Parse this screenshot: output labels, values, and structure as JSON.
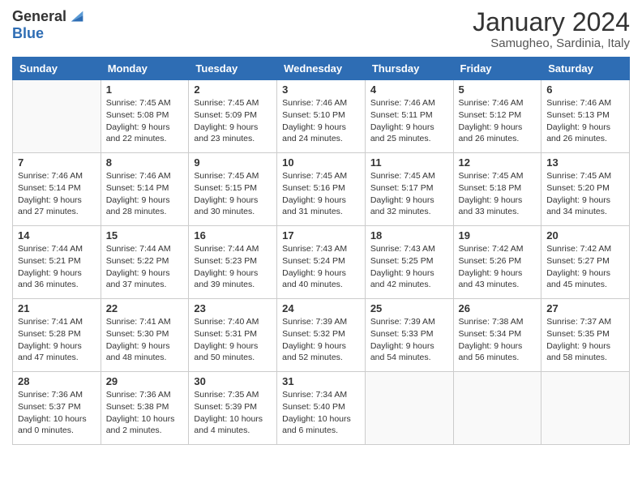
{
  "logo": {
    "text_general": "General",
    "text_blue": "Blue"
  },
  "header": {
    "month_title": "January 2024",
    "location": "Samugheo, Sardinia, Italy"
  },
  "weekdays": [
    "Sunday",
    "Monday",
    "Tuesday",
    "Wednesday",
    "Thursday",
    "Friday",
    "Saturday"
  ],
  "weeks": [
    [
      {
        "day": "",
        "sunrise": "",
        "sunset": "",
        "daylight": ""
      },
      {
        "day": "1",
        "sunrise": "Sunrise: 7:45 AM",
        "sunset": "Sunset: 5:08 PM",
        "daylight": "Daylight: 9 hours and 22 minutes."
      },
      {
        "day": "2",
        "sunrise": "Sunrise: 7:45 AM",
        "sunset": "Sunset: 5:09 PM",
        "daylight": "Daylight: 9 hours and 23 minutes."
      },
      {
        "day": "3",
        "sunrise": "Sunrise: 7:46 AM",
        "sunset": "Sunset: 5:10 PM",
        "daylight": "Daylight: 9 hours and 24 minutes."
      },
      {
        "day": "4",
        "sunrise": "Sunrise: 7:46 AM",
        "sunset": "Sunset: 5:11 PM",
        "daylight": "Daylight: 9 hours and 25 minutes."
      },
      {
        "day": "5",
        "sunrise": "Sunrise: 7:46 AM",
        "sunset": "Sunset: 5:12 PM",
        "daylight": "Daylight: 9 hours and 26 minutes."
      },
      {
        "day": "6",
        "sunrise": "Sunrise: 7:46 AM",
        "sunset": "Sunset: 5:13 PM",
        "daylight": "Daylight: 9 hours and 26 minutes."
      }
    ],
    [
      {
        "day": "7",
        "sunrise": "Sunrise: 7:46 AM",
        "sunset": "Sunset: 5:14 PM",
        "daylight": "Daylight: 9 hours and 27 minutes."
      },
      {
        "day": "8",
        "sunrise": "Sunrise: 7:46 AM",
        "sunset": "Sunset: 5:14 PM",
        "daylight": "Daylight: 9 hours and 28 minutes."
      },
      {
        "day": "9",
        "sunrise": "Sunrise: 7:45 AM",
        "sunset": "Sunset: 5:15 PM",
        "daylight": "Daylight: 9 hours and 30 minutes."
      },
      {
        "day": "10",
        "sunrise": "Sunrise: 7:45 AM",
        "sunset": "Sunset: 5:16 PM",
        "daylight": "Daylight: 9 hours and 31 minutes."
      },
      {
        "day": "11",
        "sunrise": "Sunrise: 7:45 AM",
        "sunset": "Sunset: 5:17 PM",
        "daylight": "Daylight: 9 hours and 32 minutes."
      },
      {
        "day": "12",
        "sunrise": "Sunrise: 7:45 AM",
        "sunset": "Sunset: 5:18 PM",
        "daylight": "Daylight: 9 hours and 33 minutes."
      },
      {
        "day": "13",
        "sunrise": "Sunrise: 7:45 AM",
        "sunset": "Sunset: 5:20 PM",
        "daylight": "Daylight: 9 hours and 34 minutes."
      }
    ],
    [
      {
        "day": "14",
        "sunrise": "Sunrise: 7:44 AM",
        "sunset": "Sunset: 5:21 PM",
        "daylight": "Daylight: 9 hours and 36 minutes."
      },
      {
        "day": "15",
        "sunrise": "Sunrise: 7:44 AM",
        "sunset": "Sunset: 5:22 PM",
        "daylight": "Daylight: 9 hours and 37 minutes."
      },
      {
        "day": "16",
        "sunrise": "Sunrise: 7:44 AM",
        "sunset": "Sunset: 5:23 PM",
        "daylight": "Daylight: 9 hours and 39 minutes."
      },
      {
        "day": "17",
        "sunrise": "Sunrise: 7:43 AM",
        "sunset": "Sunset: 5:24 PM",
        "daylight": "Daylight: 9 hours and 40 minutes."
      },
      {
        "day": "18",
        "sunrise": "Sunrise: 7:43 AM",
        "sunset": "Sunset: 5:25 PM",
        "daylight": "Daylight: 9 hours and 42 minutes."
      },
      {
        "day": "19",
        "sunrise": "Sunrise: 7:42 AM",
        "sunset": "Sunset: 5:26 PM",
        "daylight": "Daylight: 9 hours and 43 minutes."
      },
      {
        "day": "20",
        "sunrise": "Sunrise: 7:42 AM",
        "sunset": "Sunset: 5:27 PM",
        "daylight": "Daylight: 9 hours and 45 minutes."
      }
    ],
    [
      {
        "day": "21",
        "sunrise": "Sunrise: 7:41 AM",
        "sunset": "Sunset: 5:28 PM",
        "daylight": "Daylight: 9 hours and 47 minutes."
      },
      {
        "day": "22",
        "sunrise": "Sunrise: 7:41 AM",
        "sunset": "Sunset: 5:30 PM",
        "daylight": "Daylight: 9 hours and 48 minutes."
      },
      {
        "day": "23",
        "sunrise": "Sunrise: 7:40 AM",
        "sunset": "Sunset: 5:31 PM",
        "daylight": "Daylight: 9 hours and 50 minutes."
      },
      {
        "day": "24",
        "sunrise": "Sunrise: 7:39 AM",
        "sunset": "Sunset: 5:32 PM",
        "daylight": "Daylight: 9 hours and 52 minutes."
      },
      {
        "day": "25",
        "sunrise": "Sunrise: 7:39 AM",
        "sunset": "Sunset: 5:33 PM",
        "daylight": "Daylight: 9 hours and 54 minutes."
      },
      {
        "day": "26",
        "sunrise": "Sunrise: 7:38 AM",
        "sunset": "Sunset: 5:34 PM",
        "daylight": "Daylight: 9 hours and 56 minutes."
      },
      {
        "day": "27",
        "sunrise": "Sunrise: 7:37 AM",
        "sunset": "Sunset: 5:35 PM",
        "daylight": "Daylight: 9 hours and 58 minutes."
      }
    ],
    [
      {
        "day": "28",
        "sunrise": "Sunrise: 7:36 AM",
        "sunset": "Sunset: 5:37 PM",
        "daylight": "Daylight: 10 hours and 0 minutes."
      },
      {
        "day": "29",
        "sunrise": "Sunrise: 7:36 AM",
        "sunset": "Sunset: 5:38 PM",
        "daylight": "Daylight: 10 hours and 2 minutes."
      },
      {
        "day": "30",
        "sunrise": "Sunrise: 7:35 AM",
        "sunset": "Sunset: 5:39 PM",
        "daylight": "Daylight: 10 hours and 4 minutes."
      },
      {
        "day": "31",
        "sunrise": "Sunrise: 7:34 AM",
        "sunset": "Sunset: 5:40 PM",
        "daylight": "Daylight: 10 hours and 6 minutes."
      },
      {
        "day": "",
        "sunrise": "",
        "sunset": "",
        "daylight": ""
      },
      {
        "day": "",
        "sunrise": "",
        "sunset": "",
        "daylight": ""
      },
      {
        "day": "",
        "sunrise": "",
        "sunset": "",
        "daylight": ""
      }
    ]
  ]
}
